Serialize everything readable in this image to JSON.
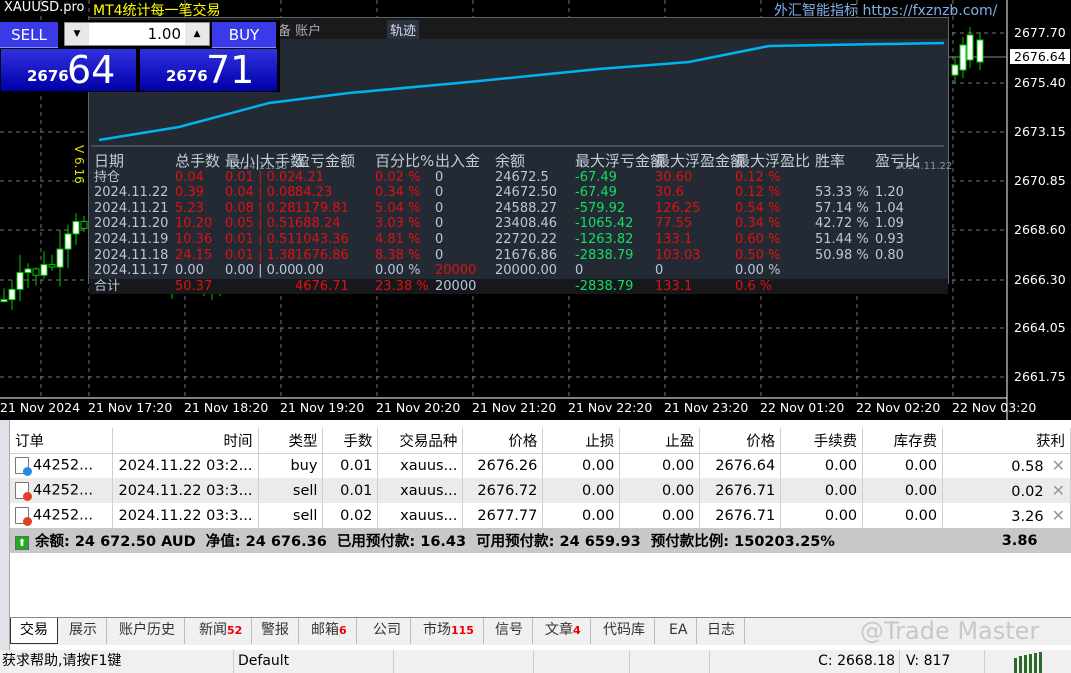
{
  "window": {
    "symbol_tab": "XAUUSD.pro",
    "indicator_title": "MT4统计每一笔交易",
    "ad_text": "外汇智能指标 https://fxznzb.com/",
    "version": "V 6.16"
  },
  "trade_panel": {
    "sell_label": "SELL",
    "buy_label": "BUY",
    "lot": "1.00",
    "sell_price_prefix": "2676",
    "sell_price_main": "64",
    "buy_price_prefix": "2676",
    "buy_price_main": "71"
  },
  "price_axis": [
    "2677.70",
    "2676.64",
    "2675.40",
    "2673.15",
    "2670.85",
    "2668.60",
    "2666.30",
    "2664.05",
    "2661.75"
  ],
  "time_axis": [
    "21 Nov 2024",
    "21 Nov 17:20",
    "21 Nov 18:20",
    "21 Nov 19:20",
    "21 Nov 20:20",
    "21 Nov 21:20",
    "21 Nov 22:20",
    "21 Nov 23:20",
    "22 Nov 01:20",
    "22 Nov 02:20",
    "22 Nov 03:20"
  ],
  "stats_panel": {
    "tabs": [
      "备 账户",
      "轨迹"
    ],
    "graph_dates": [
      "2024.11.18",
      "2024.11.22"
    ],
    "headers": [
      "日期",
      "总手数",
      "最小|大手数",
      "盈亏金额",
      "百分比%",
      "出入金",
      "余额",
      "最大浮亏金额",
      "最大浮盈金额",
      "最大浮盈比",
      "胜率",
      "盈亏比"
    ],
    "rows": [
      [
        "持仓",
        "0.04",
        "0.01 | 0.02",
        "4.21",
        "0.02 %",
        "0",
        "24672.5",
        "-67.49",
        "30.60",
        "0.12 %",
        "",
        ""
      ],
      [
        "2024.11.22",
        "0.39",
        "0.04 | 0.08",
        "84.23",
        "0.34 %",
        "0",
        "24672.50",
        "-67.49",
        "30.6",
        "0.12 %",
        "53.33 %",
        "1.20"
      ],
      [
        "2024.11.21",
        "5.23",
        "0.08 | 0.28",
        "1179.81",
        "5.04 %",
        "0",
        "24588.27",
        "-579.92",
        "126.25",
        "0.54 %",
        "57.14 %",
        "1.04"
      ],
      [
        "2024.11.20",
        "10.20",
        "0.05 | 0.51",
        "688.24",
        "3.03 %",
        "0",
        "23408.46",
        "-1065.42",
        "77.55",
        "0.34 %",
        "42.72 %",
        "1.09"
      ],
      [
        "2024.11.19",
        "10.36",
        "0.01 | 0.51",
        "1043.36",
        "4.81 %",
        "0",
        "22720.22",
        "-1263.82",
        "133.1",
        "0.60 %",
        "51.44 %",
        "0.93"
      ],
      [
        "2024.11.18",
        "24.15",
        "0.01 | 1.38",
        "1676.86",
        "8.38 %",
        "0",
        "21676.86",
        "-2838.79",
        "103.03",
        "0.50 %",
        "50.98 %",
        "0.80"
      ],
      [
        "2024.11.17",
        "0.00",
        "0.00 | 0.00",
        "0.00",
        "0.00 %",
        "20000",
        "20000.00",
        "0",
        "0",
        "0.00 %",
        "",
        ""
      ]
    ],
    "total": [
      "合计",
      "50.37",
      "",
      "4676.71",
      "23.38 %",
      "20000",
      "",
      "-2838.79",
      "133.1",
      "0.6 %",
      "",
      ""
    ]
  },
  "orders": {
    "headers": [
      "订单",
      "时间",
      "类型",
      "手数",
      "交易品种",
      "价格",
      "止损",
      "止盈",
      "价格",
      "手续费",
      "库存费",
      "获利"
    ],
    "rows": [
      {
        "order": "44252...",
        "time": "2024.11.22 03:2...",
        "type": "buy",
        "lots": "0.01",
        "symbol": "xauus...",
        "open": "2676.26",
        "sl": "0.00",
        "tp": "0.00",
        "price": "2676.64",
        "commission": "0.00",
        "swap": "0.00",
        "profit": "0.58"
      },
      {
        "order": "44252...",
        "time": "2024.11.22 03:3...",
        "type": "sell",
        "lots": "0.01",
        "symbol": "xauus...",
        "open": "2676.72",
        "sl": "0.00",
        "tp": "0.00",
        "price": "2676.71",
        "commission": "0.00",
        "swap": "0.00",
        "profit": "0.02"
      },
      {
        "order": "44252...",
        "time": "2024.11.22 03:3...",
        "type": "sell",
        "lots": "0.02",
        "symbol": "xauus...",
        "open": "2677.77",
        "sl": "0.00",
        "tp": "0.00",
        "price": "2676.71",
        "commission": "0.00",
        "swap": "0.00",
        "profit": "3.26"
      }
    ],
    "summary": "余额: 24 672.50 AUD  净值: 24 676.36  已用预付款: 16.43  可用预付款: 24 659.93  预付款比例: 150203.25%",
    "summary_profit": "3.86"
  },
  "tabs": [
    {
      "label": "交易"
    },
    {
      "label": "展示"
    },
    {
      "label": "账户历史"
    },
    {
      "label": "新闻",
      "badge": "52"
    },
    {
      "label": "警报"
    },
    {
      "label": "邮箱",
      "badge": "6"
    },
    {
      "label": "公司"
    },
    {
      "label": "市场",
      "badge": "115"
    },
    {
      "label": "信号"
    },
    {
      "label": "文章",
      "badge": "4"
    },
    {
      "label": "代码库"
    },
    {
      "label": "EA"
    },
    {
      "label": "日志"
    }
  ],
  "watermark": "@Trade Master",
  "statusbar": {
    "help": "获求帮助,请按F1键",
    "profile": "Default",
    "close": "C: 2668.18",
    "volume": "V: 817"
  },
  "colors": {
    "chart_bg": "#000000",
    "panel_bg": "#232a34",
    "equity_line": "#00b4f0",
    "loss": "#e01010",
    "gain": "#10e060",
    "sell_btn": "#3a3ae8"
  }
}
